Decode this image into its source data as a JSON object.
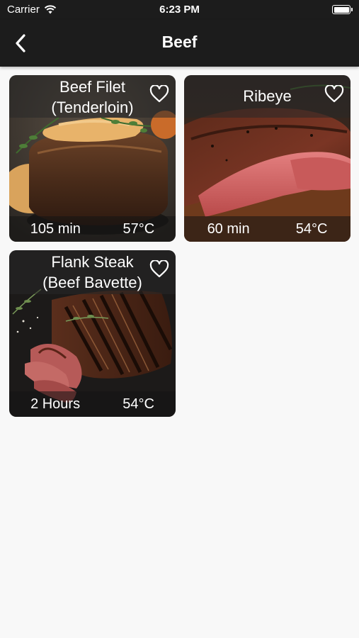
{
  "status_bar": {
    "carrier": "Carrier",
    "time": "6:23 PM"
  },
  "nav": {
    "title": "Beef",
    "back_icon": "chevron-left-icon"
  },
  "recipes": [
    {
      "name": "Beef Filet (Tenderloin)",
      "time": "105 min",
      "temperature": "57°C",
      "favorite_icon": "heart-outline-icon"
    },
    {
      "name": "Ribeye",
      "time": "60 min",
      "temperature": "54°C",
      "favorite_icon": "heart-outline-icon"
    },
    {
      "name": "Flank Steak (Beef Bavette)",
      "time": "2 Hours",
      "temperature": "54°C",
      "favorite_icon": "heart-outline-icon"
    }
  ],
  "colors": {
    "bar_background": "#1c1c1c",
    "page_background": "#f8f8f8"
  }
}
